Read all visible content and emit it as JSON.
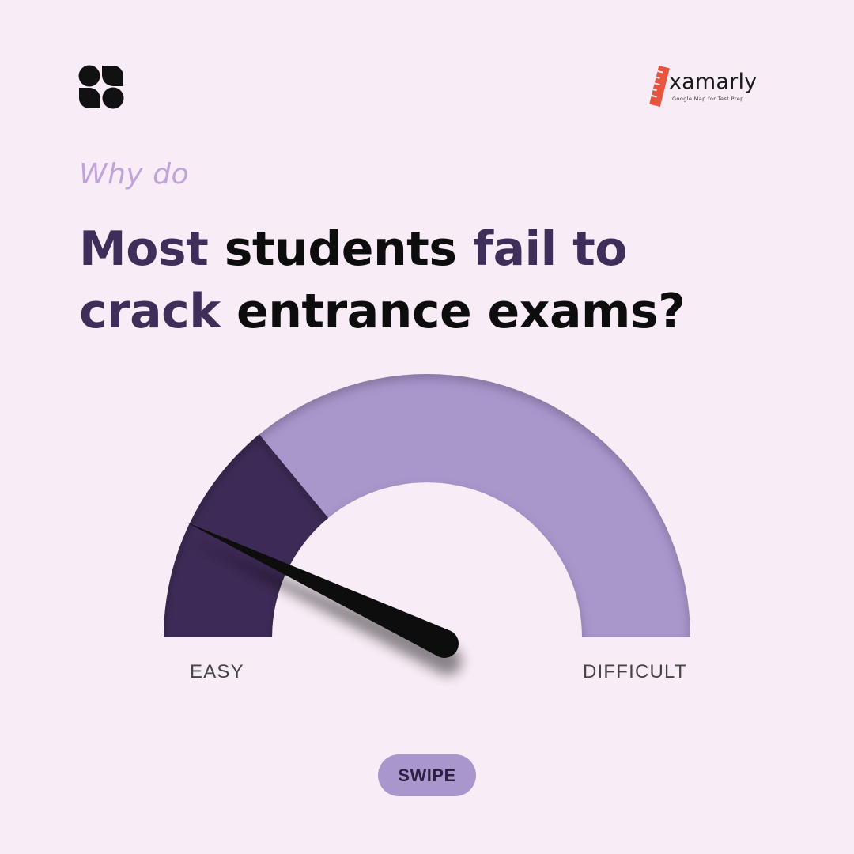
{
  "brand": {
    "icon": "four-petal-logo-icon",
    "logo_text": "xamarly",
    "logo_tagline": "Google Map for Test Prep",
    "logo_color": "#e8553e"
  },
  "headline": {
    "eyebrow": "Why do",
    "line1": [
      {
        "text": "Most ",
        "style": "muted"
      },
      {
        "text": "students ",
        "style": "strong"
      },
      {
        "text": "fail to",
        "style": "muted"
      }
    ],
    "line2": [
      {
        "text": "crack ",
        "style": "muted"
      },
      {
        "text": "entrance exams?",
        "style": "strong"
      }
    ]
  },
  "gauge": {
    "label_min": "EASY",
    "label_max": "DIFFICULT",
    "level": 0.14,
    "colors": {
      "filled": "#3d2c57",
      "track": "#a997cc",
      "needle": "#0a0a0a"
    }
  },
  "cta": {
    "label": "SWIPE"
  },
  "colors": {
    "background": "#f8ecf6",
    "accent_light": "#c0a5dd",
    "accent_dark": "#3e2f5a"
  }
}
